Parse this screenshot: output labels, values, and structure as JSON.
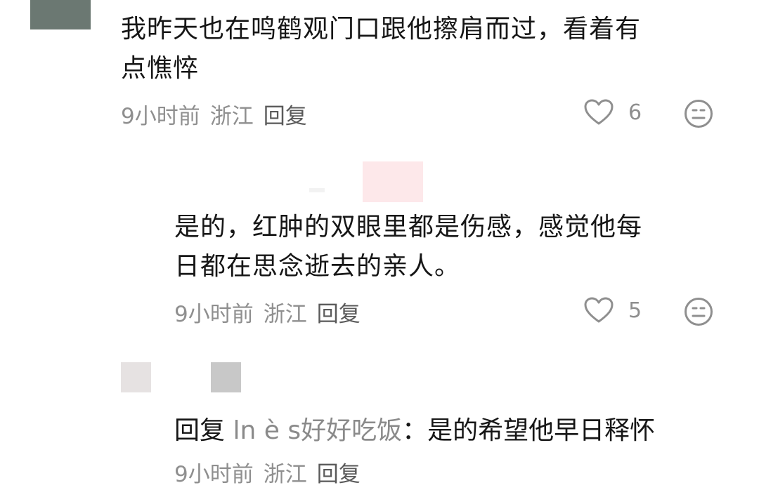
{
  "comments": [
    {
      "text_line1": "我昨天也在鸣鹤观门口跟他擦肩而过，看着有",
      "text_line2": "点憔悴",
      "time": "9小时前",
      "location": "浙江",
      "reply_label": "回复",
      "likes": "6"
    },
    {
      "text_line1": "是的，红肿的双眼里都是伤感，感觉他每",
      "text_line2": "日都在思念逝去的亲人。",
      "time": "9小时前",
      "location": "浙江",
      "reply_label": "回复",
      "likes": "5"
    },
    {
      "reply_prefix": "回复",
      "reply_target": "ln è s好好吃饭",
      "reply_colon": "：",
      "reply_text": "是的希望他早日释怀",
      "time": "9小时前",
      "location": "浙江",
      "reply_label": "回复"
    }
  ],
  "icons": {
    "like": "heart-icon",
    "emoji": "neutral-face-icon"
  },
  "colors": {
    "meta": "#8f8f8f",
    "text": "#161616",
    "avatar_gray": "#6b7872",
    "blur_pink": "#fde8ea",
    "blur_light": "#e6e2e2",
    "blur_mid": "#c8c8c8"
  }
}
